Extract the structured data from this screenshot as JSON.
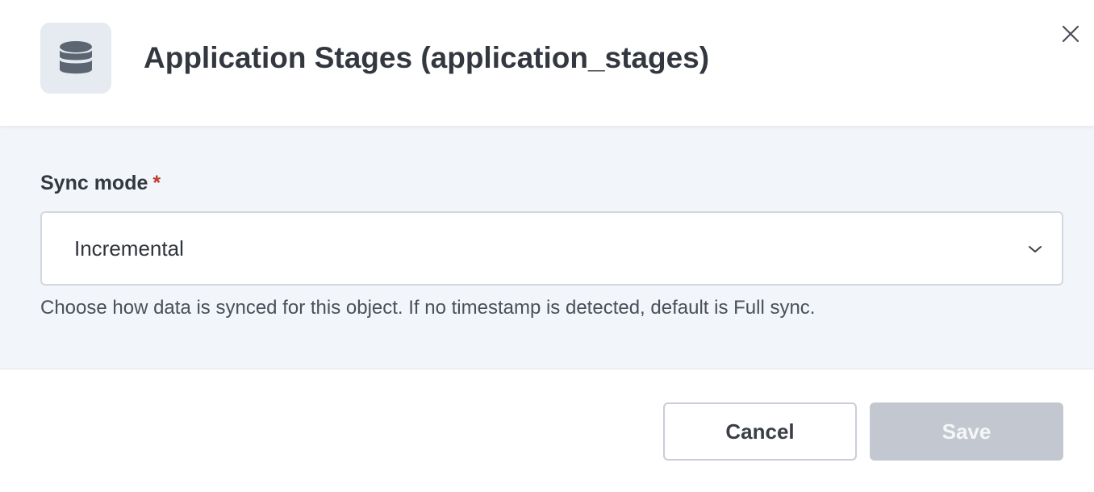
{
  "dialog": {
    "title": "Application Stages (application_stages)",
    "header_icon": "database-icon",
    "close_icon": "close-icon"
  },
  "form": {
    "sync_mode": {
      "label": "Sync mode",
      "required_marker": "*",
      "selected_value": "Incremental",
      "chevron_icon": "chevron-down-icon",
      "help_text": "Choose how data is synced for this object. If no timestamp is detected, default is Full sync."
    }
  },
  "footer": {
    "cancel_label": "Cancel",
    "save_label": "Save"
  },
  "colors": {
    "body_background": "#f2f5f9",
    "required_marker": "#c0392b",
    "save_disabled_background": "#c3c8d0",
    "icon_box_background": "#e6eaf1"
  }
}
